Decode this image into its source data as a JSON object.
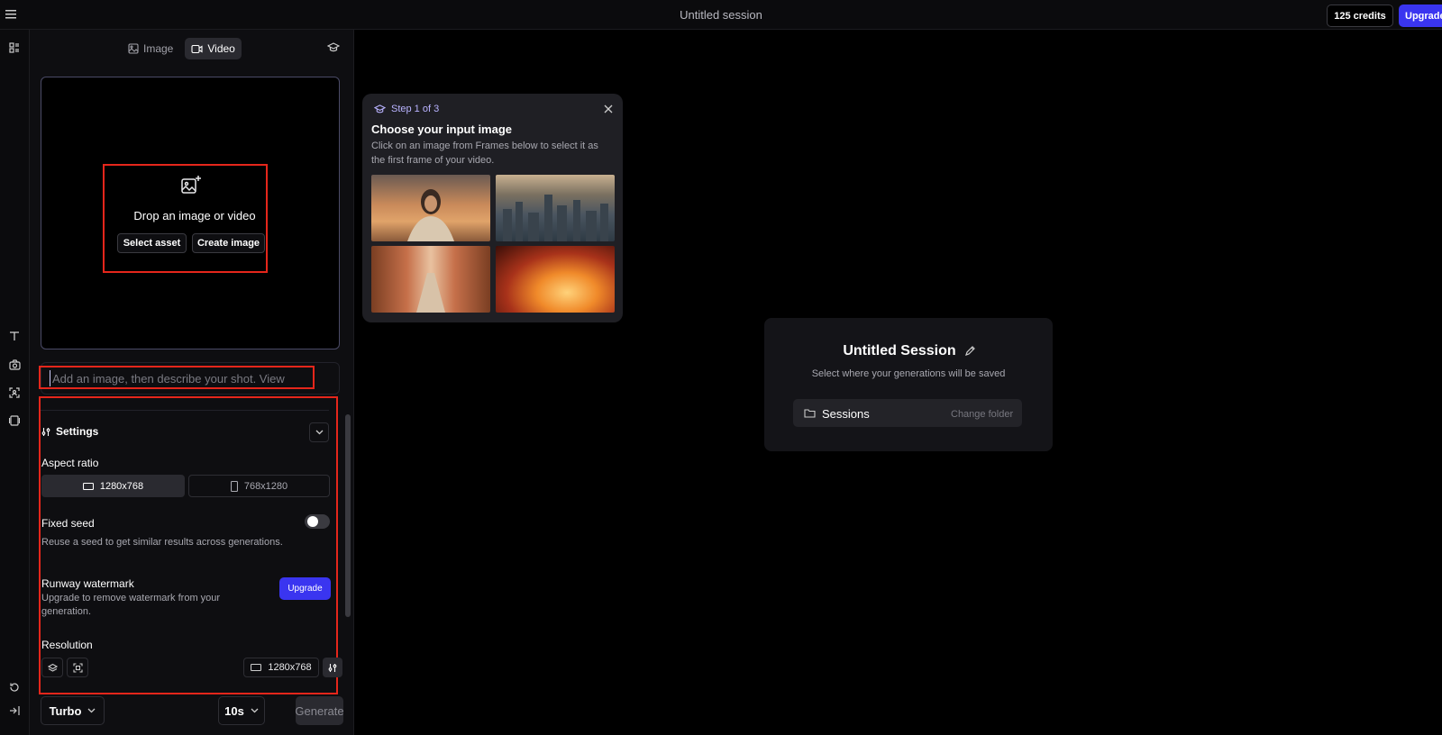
{
  "header": {
    "session_title": "Untitled session",
    "credits": "125 credits",
    "upgrade_label": "Upgrade"
  },
  "mode_tabs": [
    {
      "label": "Image",
      "icon": "image-icon",
      "active": false
    },
    {
      "label": "Video",
      "icon": "video-icon",
      "active": true
    }
  ],
  "drop_zone": {
    "title": "Drop an image or video",
    "select_asset_label": "Select asset",
    "create_image_label": "Create image"
  },
  "prompt": {
    "placeholder": "Add an image, then describe your shot. View ...",
    "value": ""
  },
  "settings": {
    "title": "Settings",
    "aspect_ratio": {
      "label": "Aspect ratio",
      "options": [
        {
          "label": "1280x768",
          "selected": true
        },
        {
          "label": "768x1280",
          "selected": false
        }
      ]
    },
    "fixed_seed": {
      "label": "Fixed seed",
      "description": "Reuse a seed to get similar results across generations.",
      "enabled": false
    },
    "watermark": {
      "label": "Runway watermark",
      "description": "Upgrade to remove watermark from your generation.",
      "button_label": "Upgrade"
    },
    "resolution": {
      "label": "Resolution",
      "value": "1280x768"
    }
  },
  "footer": {
    "model_label": "Turbo",
    "duration_label": "10s",
    "generate_label": "Generate"
  },
  "tour": {
    "step": "Step 1 of 3",
    "title": "Choose your input image",
    "description": "Click on an image from Frames below to select it as the first frame of your video.",
    "thumbnails": [
      "portrait-at-sunset",
      "city-aerial",
      "canyon-road",
      "fire"
    ]
  },
  "session_card": {
    "title": "Untitled Session",
    "subtitle": "Select where your generations will be saved",
    "folder_name": "Sessions",
    "change_folder_label": "Change folder"
  },
  "colors": {
    "accent": "#3a35f0",
    "highlight_box": "#e5261b",
    "tour_accent": "#b9b3ff"
  }
}
